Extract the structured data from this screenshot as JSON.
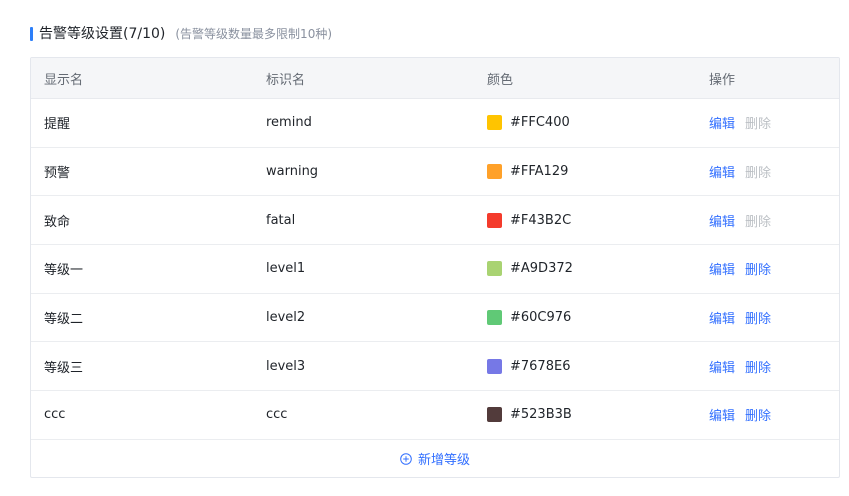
{
  "header": {
    "title": "告警等级设置(7/10)",
    "hint": "(告警等级数量最多限制10种)"
  },
  "table": {
    "columns": [
      "显示名",
      "标识名",
      "颜色",
      "操作"
    ],
    "rows": [
      {
        "display": "提醒",
        "key": "remind",
        "color": "#FFC400",
        "edit": "编辑",
        "delete": "删除",
        "deletable": false
      },
      {
        "display": "预警",
        "key": "warning",
        "color": "#FFA129",
        "edit": "编辑",
        "delete": "删除",
        "deletable": false
      },
      {
        "display": "致命",
        "key": "fatal",
        "color": "#F43B2C",
        "edit": "编辑",
        "delete": "删除",
        "deletable": false
      },
      {
        "display": "等级一",
        "key": "level1",
        "color": "#A9D372",
        "edit": "编辑",
        "delete": "删除",
        "deletable": true
      },
      {
        "display": "等级二",
        "key": "level2",
        "color": "#60C976",
        "edit": "编辑",
        "delete": "删除",
        "deletable": true
      },
      {
        "display": "等级三",
        "key": "level3",
        "color": "#7678E6",
        "edit": "编辑",
        "delete": "删除",
        "deletable": true
      },
      {
        "display": "ccc",
        "key": "ccc",
        "color": "#523B3B",
        "edit": "编辑",
        "delete": "删除",
        "deletable": true
      }
    ]
  },
  "footer": {
    "add_label": "新增等级"
  },
  "theme": {
    "accent": "#3370FF",
    "disabled": "#BBBFC4"
  }
}
